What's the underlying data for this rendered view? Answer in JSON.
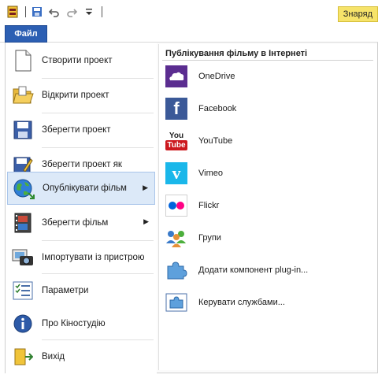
{
  "quick_access": {
    "icons": [
      "movie-app-icon",
      "save-icon",
      "undo-icon",
      "redo-icon",
      "customize-toolbar-icon"
    ],
    "tools_tab": "Знаряд"
  },
  "file_tab": {
    "label": "Файл"
  },
  "menu": {
    "items": [
      {
        "label": "Створити проект",
        "icon": "new-document-icon"
      },
      {
        "label": "Відкрити проект",
        "icon": "open-folder-icon"
      },
      {
        "label": "Зберегти проект",
        "icon": "save-disk-icon"
      },
      {
        "label": "Зберегти проект як",
        "icon": "save-as-icon"
      },
      {
        "label": "Опублікувати фільм",
        "icon": "globe-publish-icon",
        "submenu": true,
        "selected": true
      },
      {
        "label": "Зберегти фільм",
        "icon": "film-save-icon",
        "submenu": true
      },
      {
        "label": "Імпортувати із пристрою",
        "icon": "camera-import-icon"
      },
      {
        "label": "Параметри",
        "icon": "options-list-icon"
      },
      {
        "label": "Про Кіностудію",
        "icon": "info-icon"
      },
      {
        "label": "Вихід",
        "icon": "exit-folder-icon"
      }
    ]
  },
  "publish_panel": {
    "heading": "Публікування фільму в Інтернеті",
    "items": [
      {
        "label": "OneDrive",
        "icon": "onedrive-icon"
      },
      {
        "label": "Facebook",
        "icon": "facebook-icon"
      },
      {
        "label": "YouTube",
        "icon": "youtube-icon"
      },
      {
        "label": "Vimeo",
        "icon": "vimeo-icon"
      },
      {
        "label": "Flickr",
        "icon": "flickr-icon"
      },
      {
        "label": "Групи",
        "icon": "groups-icon"
      },
      {
        "label": "Додати компонент plug-in...",
        "icon": "puzzle-plugin-icon"
      },
      {
        "label": "Керувати службами...",
        "icon": "manage-services-icon"
      }
    ],
    "youtube_logo_top": "You",
    "youtube_logo_bottom": "Tube",
    "facebook_logo": "f",
    "vimeo_logo": "v"
  },
  "colors": {
    "file_tab": "#2c5fb3",
    "selection": "#dce9f8",
    "onedrive": "#5b2d90",
    "facebook": "#3b5998",
    "youtube_red": "#cc181e",
    "vimeo": "#1ab7ea",
    "flickr_blue": "#0063dc",
    "flickr_pink": "#ff0084"
  }
}
